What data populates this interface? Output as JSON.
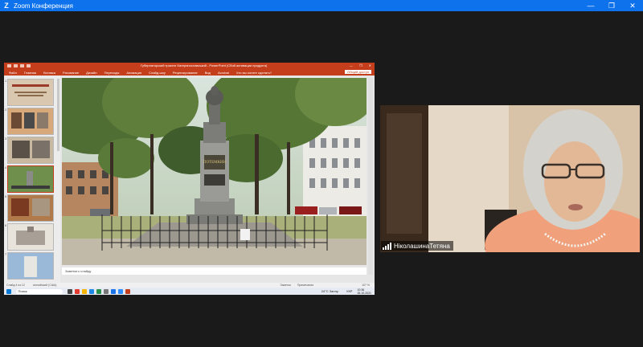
{
  "zoom": {
    "window_title": "Zoom Конференция",
    "logo_letter": "Z",
    "controls": {
      "minimize": "—",
      "restore": "❐",
      "close": "✕"
    }
  },
  "powerpoint": {
    "doc_title": "Губернаторский трактат Катеринославський - PowerPoint (Сбой активации продукта)",
    "ribbon_tabs": [
      "Файл",
      "Главная",
      "Вставка",
      "Рисование",
      "Дизайн",
      "Переходы",
      "Анимация",
      "Слайд-шоу",
      "Рецензирование",
      "Вид",
      "Acrobat"
    ],
    "tell_me": "Что вы хотите сделать?",
    "share_label": "Общий доступ",
    "notes_placeholder": "Заметки к слайду",
    "status": {
      "slide_count": "Слайд 4 из 12",
      "language": "английский (США)",
      "notes_btn": "Заметки",
      "comments_btn": "Примечания",
      "zoom": "107 %"
    },
    "thumb_numbers": [
      "1",
      "2",
      "3",
      "4",
      "5",
      "6",
      "7"
    ],
    "slide_plaque": "ПОТЕМКИН"
  },
  "taskbar": {
    "search_label": "Поиск",
    "weather": "24°C Занлу",
    "lang": "УКР",
    "time": "10:36",
    "date": "26.10.2021"
  },
  "participant": {
    "name": "НіколашинаТетяна"
  }
}
